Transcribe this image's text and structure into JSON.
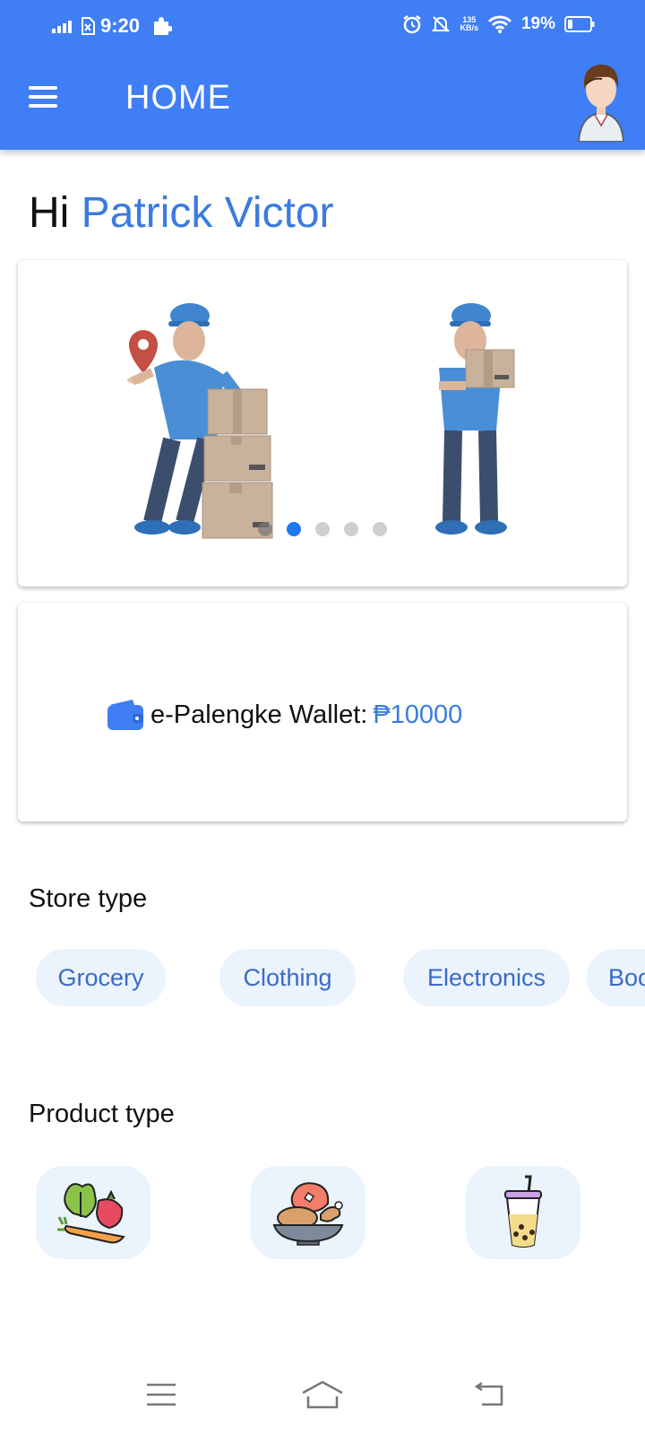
{
  "status_bar": {
    "time": "9:20",
    "network_speed_value": "135",
    "network_speed_unit": "KB/s",
    "battery": "19%",
    "icons": [
      "signal-icon",
      "no-sim-icon",
      "puzzle-icon",
      "alarm-icon",
      "mute-icon",
      "wifi-icon",
      "battery-icon"
    ]
  },
  "header": {
    "title": "HOME",
    "menu_icon": "hamburger-menu-icon",
    "avatar_icon": "user-avatar"
  },
  "greeting": {
    "prefix": "Hi",
    "name": "Patrick Victor"
  },
  "carousel": {
    "slide_count": 5,
    "active_index": 1,
    "illustrations": [
      "delivery-man-with-boxes",
      "delivery-man-holding-box"
    ]
  },
  "wallet": {
    "label": "e-Palengke Wallet:",
    "amount": "₱10000",
    "icon": "wallet-icon"
  },
  "store_type": {
    "title": "Store type",
    "chips": [
      "Grocery",
      "Clothing",
      "Electronics",
      "Boo"
    ]
  },
  "product_type": {
    "title": "Product type",
    "icons": [
      "vegetables-icon",
      "meat-food-icon",
      "milk-tea-icon"
    ]
  },
  "nav_bar": {
    "icons": [
      "recent-apps-icon",
      "home-icon",
      "back-icon"
    ]
  },
  "colors": {
    "primary": "#3f7ef5",
    "accent_text": "#3b7be0",
    "chip_bg": "#ebf3fd",
    "chip_text": "#3a6bc4",
    "dot_active": "#1e78f0"
  }
}
